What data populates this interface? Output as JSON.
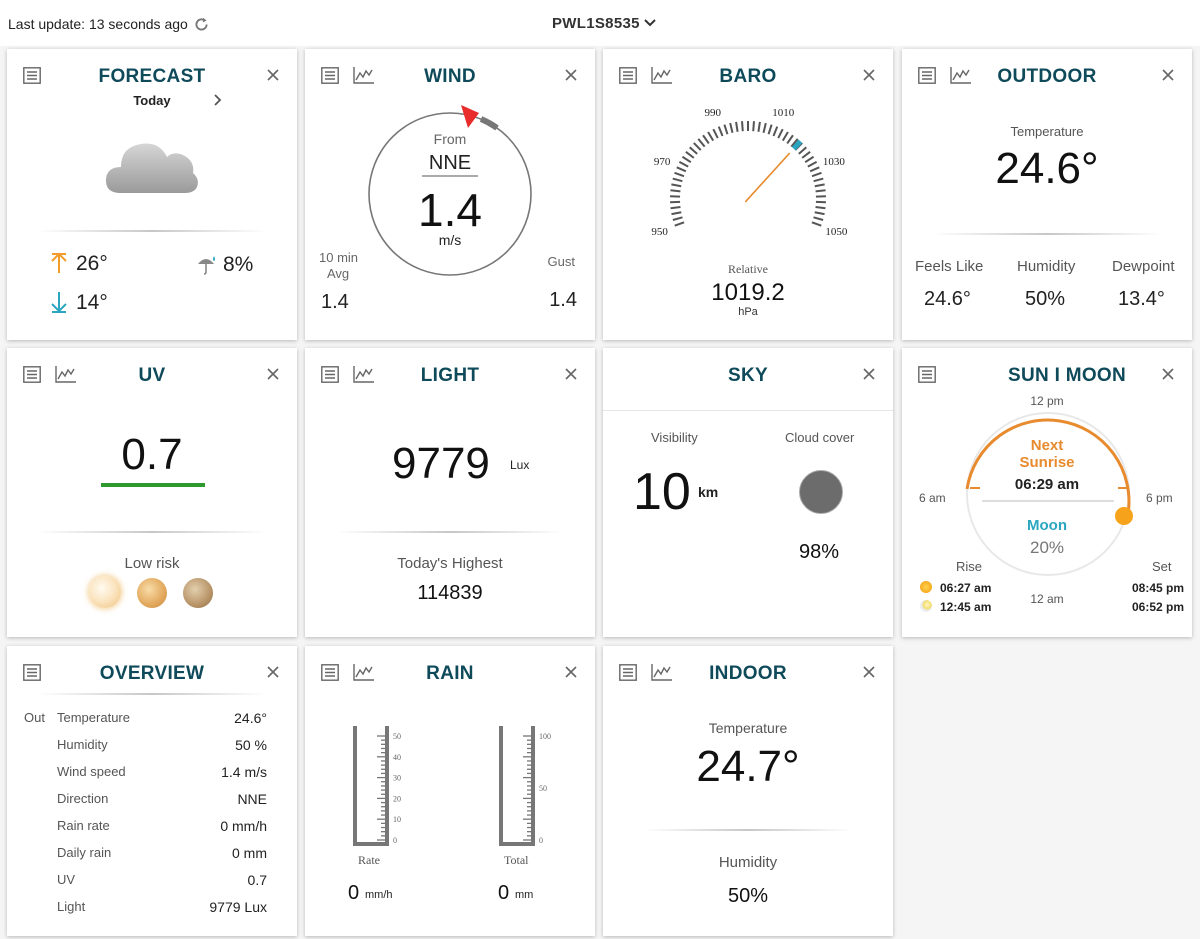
{
  "header": {
    "last_update": "Last update: 13 seconds ago",
    "station": "PWL1S8535"
  },
  "colors": {
    "title": "#0f4a5a",
    "orange": "#e88a2e",
    "teal": "#2aa6c0",
    "uv_green": "#2e9a2e",
    "red_pointer": "#e82b2b"
  },
  "forecast": {
    "title": "FORECAST",
    "day": "Today",
    "high": "26°",
    "low": "14°",
    "precip": "8%",
    "icons": [
      "cloud-icon",
      "arrow-up-icon",
      "arrow-down-icon",
      "umbrella-icon"
    ]
  },
  "wind": {
    "title": "WIND",
    "from_label": "From",
    "direction": "NNE",
    "speed": "1.4",
    "unit": "m/s",
    "avg_label_1": "10 min",
    "avg_label_2": "Avg",
    "avg_value": "1.4",
    "gust_label": "Gust",
    "gust_value": "1.4"
  },
  "baro": {
    "title": "BARO",
    "ticks": [
      "950",
      "970",
      "990",
      "1010",
      "1030",
      "1050"
    ],
    "relative_label": "Relative",
    "value": "1019.2",
    "unit": "hPa",
    "gauge_value": 1019.2
  },
  "outdoor": {
    "title": "OUTDOOR",
    "temp_label": "Temperature",
    "temp": "24.6°",
    "feels_label": "Feels Like",
    "feels": "24.6°",
    "humidity_label": "Humidity",
    "humidity": "50%",
    "dewpoint_label": "Dewpoint",
    "dewpoint": "13.4°"
  },
  "uv": {
    "title": "UV",
    "value": "0.7",
    "risk": "Low risk"
  },
  "light": {
    "title": "LIGHT",
    "value": "9779",
    "unit": "Lux",
    "highest_label": "Today's Highest",
    "highest": "114839"
  },
  "sky": {
    "title": "SKY",
    "visibility_label": "Visibility",
    "visibility": "10",
    "visibility_unit": "km",
    "cloud_label": "Cloud cover",
    "cloud": "98%"
  },
  "sunmoon": {
    "title": "SUN I MOON",
    "noon": "12 pm",
    "am6": "6 am",
    "pm6": "6 pm",
    "midnight": "12 am",
    "next_1": "Next",
    "next_2": "Sunrise",
    "next_time": "06:29 am",
    "moon_label": "Moon",
    "moon_pct": "20%",
    "rise_label": "Rise",
    "set_label": "Set",
    "sun_rise": "06:27 am",
    "moon_rise": "12:45 am",
    "sun_set": "08:45 pm",
    "moon_set": "06:52 pm"
  },
  "overview": {
    "title": "OVERVIEW",
    "out_label": "Out",
    "rows": [
      {
        "label": "Temperature",
        "value": "24.6°"
      },
      {
        "label": "Humidity",
        "value": "50 %"
      },
      {
        "label": "Wind speed",
        "value": "1.4 m/s"
      },
      {
        "label": "Direction",
        "value": "NNE"
      },
      {
        "label": "Rain rate",
        "value": "0 mm/h"
      },
      {
        "label": "Daily rain",
        "value": "0 mm"
      },
      {
        "label": "UV",
        "value": "0.7"
      },
      {
        "label": "Light",
        "value": "9779 Lux"
      }
    ]
  },
  "rain": {
    "title": "RAIN",
    "rate_scale": [
      "50",
      "40",
      "30",
      "20",
      "10",
      "0"
    ],
    "total_scale": [
      "100",
      "50",
      "0"
    ],
    "rate_label": "Rate",
    "total_label": "Total",
    "rate_value": "0",
    "rate_unit": "mm/h",
    "total_value": "0",
    "total_unit": "mm"
  },
  "indoor": {
    "title": "INDOOR",
    "temp_label": "Temperature",
    "temp": "24.7°",
    "humidity_label": "Humidity",
    "humidity": "50%"
  }
}
